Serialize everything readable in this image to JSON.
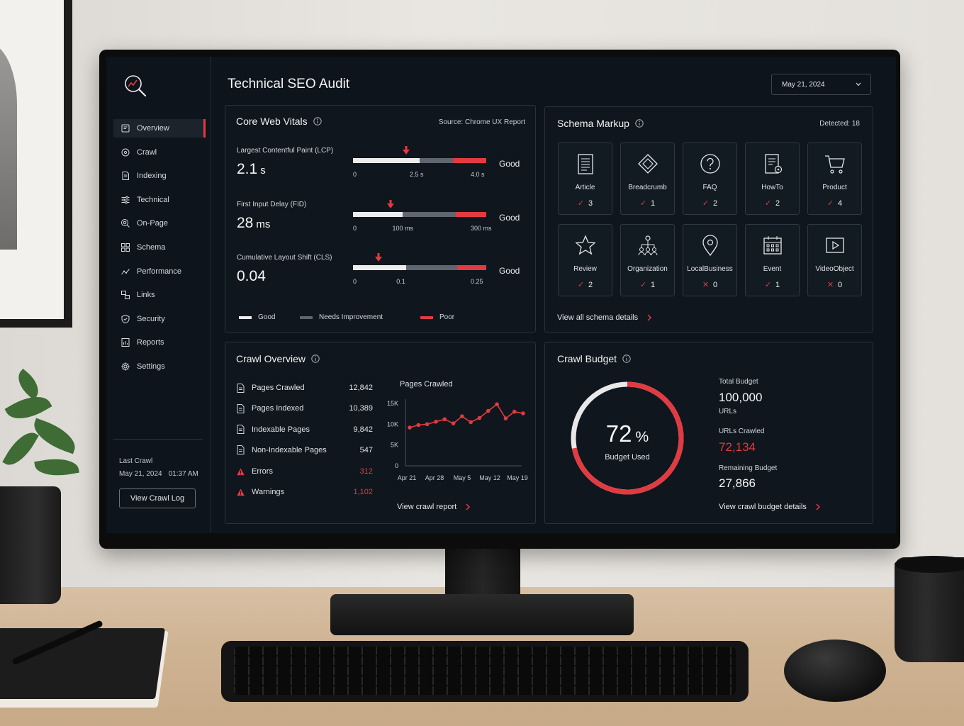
{
  "app": {
    "title": "Technical SEO Audit"
  },
  "header": {
    "date": "May 21, 2024"
  },
  "sidebar": {
    "items": [
      {
        "label": "Overview",
        "icon": "overview-icon",
        "active": true
      },
      {
        "label": "Crawl",
        "icon": "crawl-icon"
      },
      {
        "label": "Indexing",
        "icon": "indexing-icon"
      },
      {
        "label": "Technical",
        "icon": "sliders-icon"
      },
      {
        "label": "On-Page",
        "icon": "magnifier-icon"
      },
      {
        "label": "Schema",
        "icon": "grid-icon"
      },
      {
        "label": "Performance",
        "icon": "trend-icon"
      },
      {
        "label": "Links",
        "icon": "links-icon"
      },
      {
        "label": "Security",
        "icon": "shield-icon"
      },
      {
        "label": "Reports",
        "icon": "reports-icon"
      },
      {
        "label": "Settings",
        "icon": "gear-icon"
      }
    ],
    "last_crawl_label": "Last Crawl",
    "last_crawl_date": "May 21, 2024",
    "last_crawl_time": "01:37 AM",
    "crawl_log_button": "View Crawl Log"
  },
  "cwv": {
    "title": "Core Web Vitals",
    "source": "Source: Chrome UX Report",
    "metrics": [
      {
        "label": "Largest Contentful Paint (LCP)",
        "value": "2.1",
        "unit": "s",
        "status": "Good",
        "ticks": [
          "0",
          "2.5 s",
          "4.0 s"
        ],
        "marker_fraction": 0.4,
        "good_fraction": 0.5,
        "needs_fraction": 0.25
      },
      {
        "label": "First Input Delay (FID)",
        "value": "28",
        "unit": "ms",
        "status": "Good",
        "ticks": [
          "0",
          "100 ms",
          "300 ms"
        ],
        "marker_fraction": 0.28,
        "good_fraction": 0.37,
        "needs_fraction": 0.4
      },
      {
        "label": "Cumulative Layout Shift (CLS)",
        "value": "0.04",
        "unit": "",
        "status": "Good",
        "ticks": [
          "0",
          "0.1",
          "0.25"
        ],
        "marker_fraction": 0.19,
        "good_fraction": 0.4,
        "needs_fraction": 0.38
      }
    ],
    "legend": {
      "good": "Good",
      "needs": "Needs Improvement",
      "poor": "Poor"
    }
  },
  "schema": {
    "title": "Schema Markup",
    "detected": "Detected: 18",
    "items": [
      {
        "name": "Article",
        "count": "3",
        "ok": true
      },
      {
        "name": "Breadcrumb",
        "count": "1",
        "ok": true
      },
      {
        "name": "FAQ",
        "count": "2",
        "ok": true
      },
      {
        "name": "HowTo",
        "count": "2",
        "ok": true
      },
      {
        "name": "Product",
        "count": "4",
        "ok": true
      },
      {
        "name": "Review",
        "count": "2",
        "ok": true
      },
      {
        "name": "Organization",
        "count": "1",
        "ok": true
      },
      {
        "name": "LocalBusiness",
        "count": "0",
        "ok": false
      },
      {
        "name": "Event",
        "count": "1",
        "ok": true
      },
      {
        "name": "VideoObject",
        "count": "0",
        "ok": false
      }
    ],
    "view_all": "View all schema details"
  },
  "crawl": {
    "title": "Crawl Overview",
    "stats": [
      {
        "label": "Pages Crawled",
        "value": "12,842",
        "warn": false
      },
      {
        "label": "Pages Indexed",
        "value": "10,389",
        "warn": false
      },
      {
        "label": "Indexable Pages",
        "value": "9,842",
        "warn": false
      },
      {
        "label": "Non-Indexable Pages",
        "value": "547",
        "warn": false
      },
      {
        "label": "Errors",
        "value": "312",
        "warn": true
      },
      {
        "label": "Warnings",
        "value": "1,102",
        "warn": true
      }
    ],
    "view_report": "View crawl report"
  },
  "chart_data": {
    "type": "line",
    "title": "Pages Crawled",
    "xlabel": "",
    "ylabel": "",
    "x_tick_labels": [
      "Apr 21",
      "Apr 28",
      "May 5",
      "May 12",
      "May 19"
    ],
    "y_tick_labels": [
      "0",
      "5K",
      "10K",
      "15K"
    ],
    "ylim": [
      0,
      15000
    ],
    "grid": false,
    "series": [
      {
        "values": [
          9200,
          9800,
          10000,
          10600,
          11200,
          10200,
          11900,
          10500,
          11500,
          13200,
          14800,
          11400,
          13000,
          12600
        ]
      }
    ]
  },
  "budget": {
    "title": "Crawl Budget",
    "percent": "72",
    "percent_sign": "%",
    "percent_value": 72,
    "used_label": "Budget Used",
    "total_label": "Total Budget",
    "total_value": "100,000",
    "total_unit": "URLs",
    "crawled_label": "URLs Crawled",
    "crawled_value": "72,134",
    "remaining_label": "Remaining Budget",
    "remaining_value": "27,866",
    "view_link": "View crawl budget details"
  },
  "colors": {
    "accent": "#e23a41",
    "good": "#ececec",
    "needs": "#5f6670",
    "background": "#0e141b"
  }
}
